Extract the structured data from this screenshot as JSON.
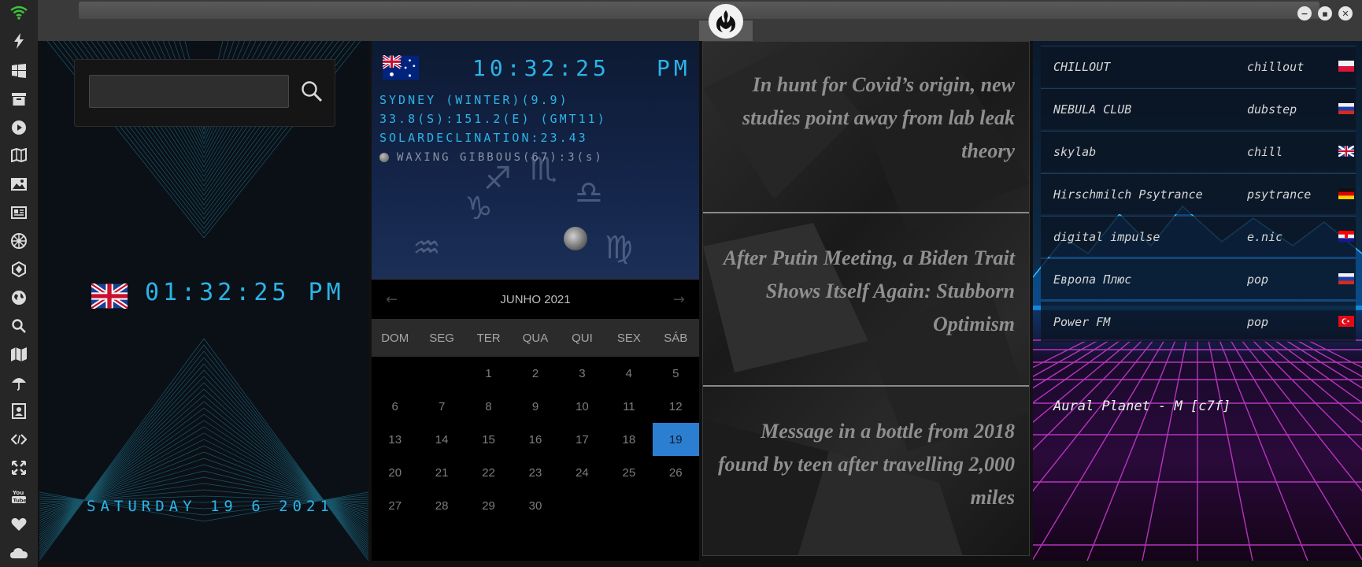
{
  "dock": {
    "icons": [
      "wifi-icon",
      "lightning-icon",
      "windows-icon",
      "archive-icon",
      "play-icon",
      "map-book-icon",
      "image-icon",
      "newspaper-icon",
      "empire-icon",
      "hexagon-icon",
      "globe-icon",
      "search-icon",
      "map-icon",
      "umbrella-icon",
      "contacts-icon",
      "code-icon",
      "expand-icon",
      "youtube-icon",
      "heart-icon",
      "cloud-icon"
    ]
  },
  "search": {
    "placeholder": "",
    "value": ""
  },
  "local_clock": {
    "time": "01:32:25 PM",
    "date": "SATURDAY 19 6 2021"
  },
  "world_clock": {
    "time": "10:32:25",
    "ampm": "PM",
    "line1": "SYDNEY (WINTER)(9.9)",
    "line2": "33.8(S):151.2(E) (GMT11)",
    "line3": "SOLARDECLINATION:23.43",
    "moon": "WAXING GIBBOUS(67):3(s)"
  },
  "calendar": {
    "month": "JUNHO 2021",
    "prev": "←",
    "next": "→",
    "weekdays": [
      "DOM",
      "SEG",
      "TER",
      "QUA",
      "QUI",
      "SEX",
      "SÁB"
    ],
    "days": [
      "",
      "",
      "1",
      "2",
      "3",
      "4",
      "5",
      "6",
      "7",
      "8",
      "9",
      "10",
      "11",
      "12",
      "13",
      "14",
      "15",
      "16",
      "17",
      "18",
      "19",
      "20",
      "21",
      "22",
      "23",
      "24",
      "25",
      "26",
      "27",
      "28",
      "29",
      "30"
    ],
    "today": "19"
  },
  "news": [
    "In hunt for Covid’s origin, new studies point away from lab leak theory",
    "After Putin Meeting, a Biden Trait Shows Itself Again: Stubborn Optimism",
    "Message in a bottle from 2018 found by teen after travelling 2,000 miles"
  ],
  "radio": {
    "stations": [
      {
        "name": "CHILLOUT",
        "genre": "chillout",
        "flag": "pl"
      },
      {
        "name": "NEBULA CLUB",
        "genre": "dubstep",
        "flag": "ru"
      },
      {
        "name": "skylab",
        "genre": "chill",
        "flag": "gb"
      },
      {
        "name": "Hirschmilch Psytrance",
        "genre": "psytrance",
        "flag": "de"
      },
      {
        "name": "digital impulse",
        "genre": "e.nic",
        "flag": "hr"
      },
      {
        "name": "Европа Плюс",
        "genre": "pop",
        "flag": "ru"
      },
      {
        "name": "Power FM",
        "genre": "pop",
        "flag": "tr"
      }
    ],
    "now_playing": "Aural Planet - M [c7f]"
  },
  "colors": {
    "accent": "#2bb4e8",
    "today": "#2c7fd0"
  }
}
